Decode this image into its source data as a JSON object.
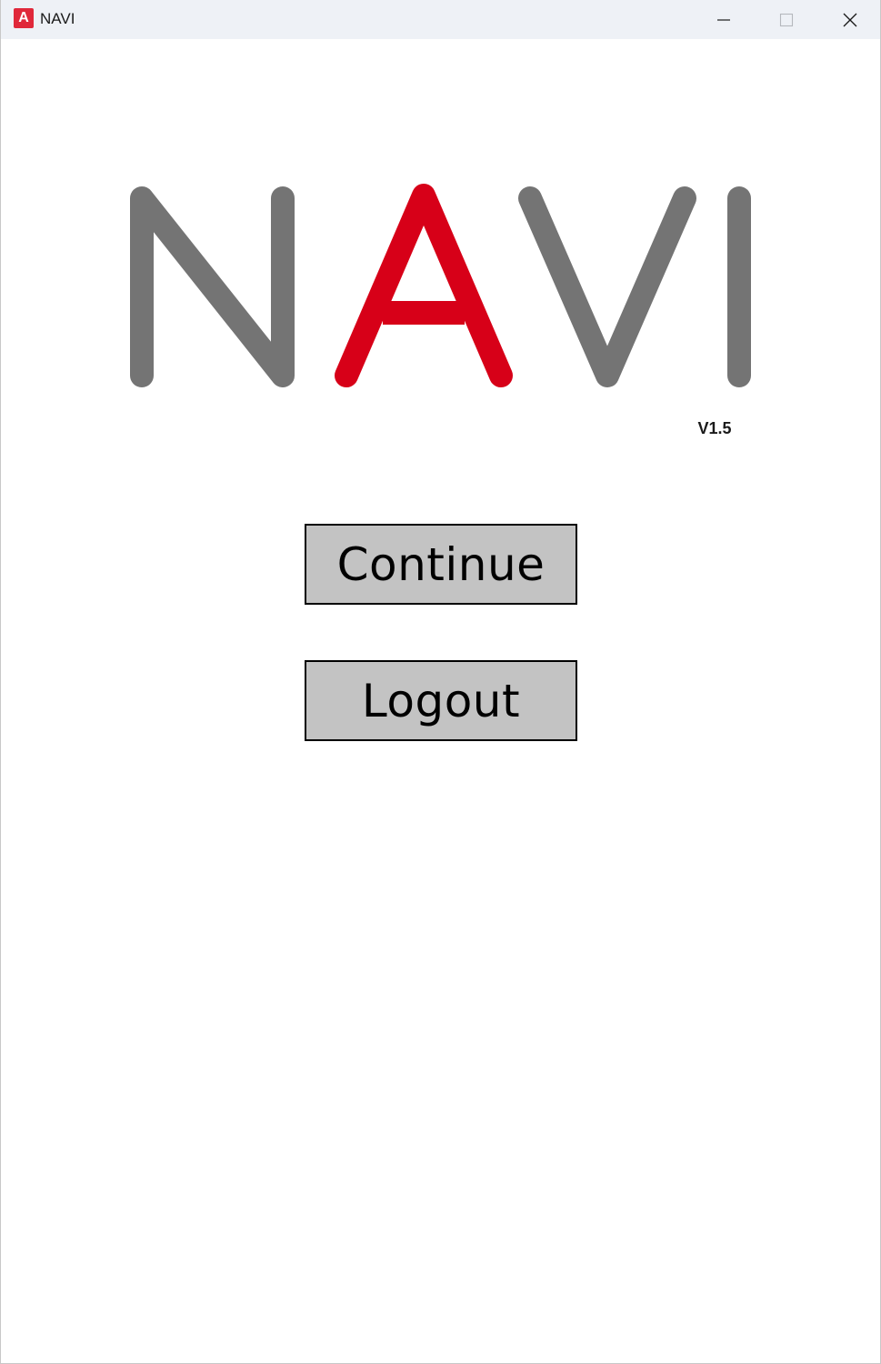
{
  "window": {
    "title": "NAVI",
    "app_icon_letter": "A",
    "app_icon_color": "#e0283a",
    "titlebar_color": "#eef1f6"
  },
  "logo": {
    "text": "NAVI",
    "letters": [
      {
        "char": "N",
        "color": "#747474"
      },
      {
        "char": "A",
        "color": "#d70018"
      },
      {
        "char": "V",
        "color": "#747474"
      },
      {
        "char": "I",
        "color": "#747474"
      }
    ]
  },
  "version": {
    "label": "V1.5"
  },
  "buttons": {
    "continue_label": "Continue",
    "logout_label": "Logout",
    "background_color": "#c3c3c3"
  },
  "controls": {
    "minimize_icon": "minimize-icon",
    "maximize_icon": "maximize-icon",
    "close_icon": "close-icon"
  }
}
